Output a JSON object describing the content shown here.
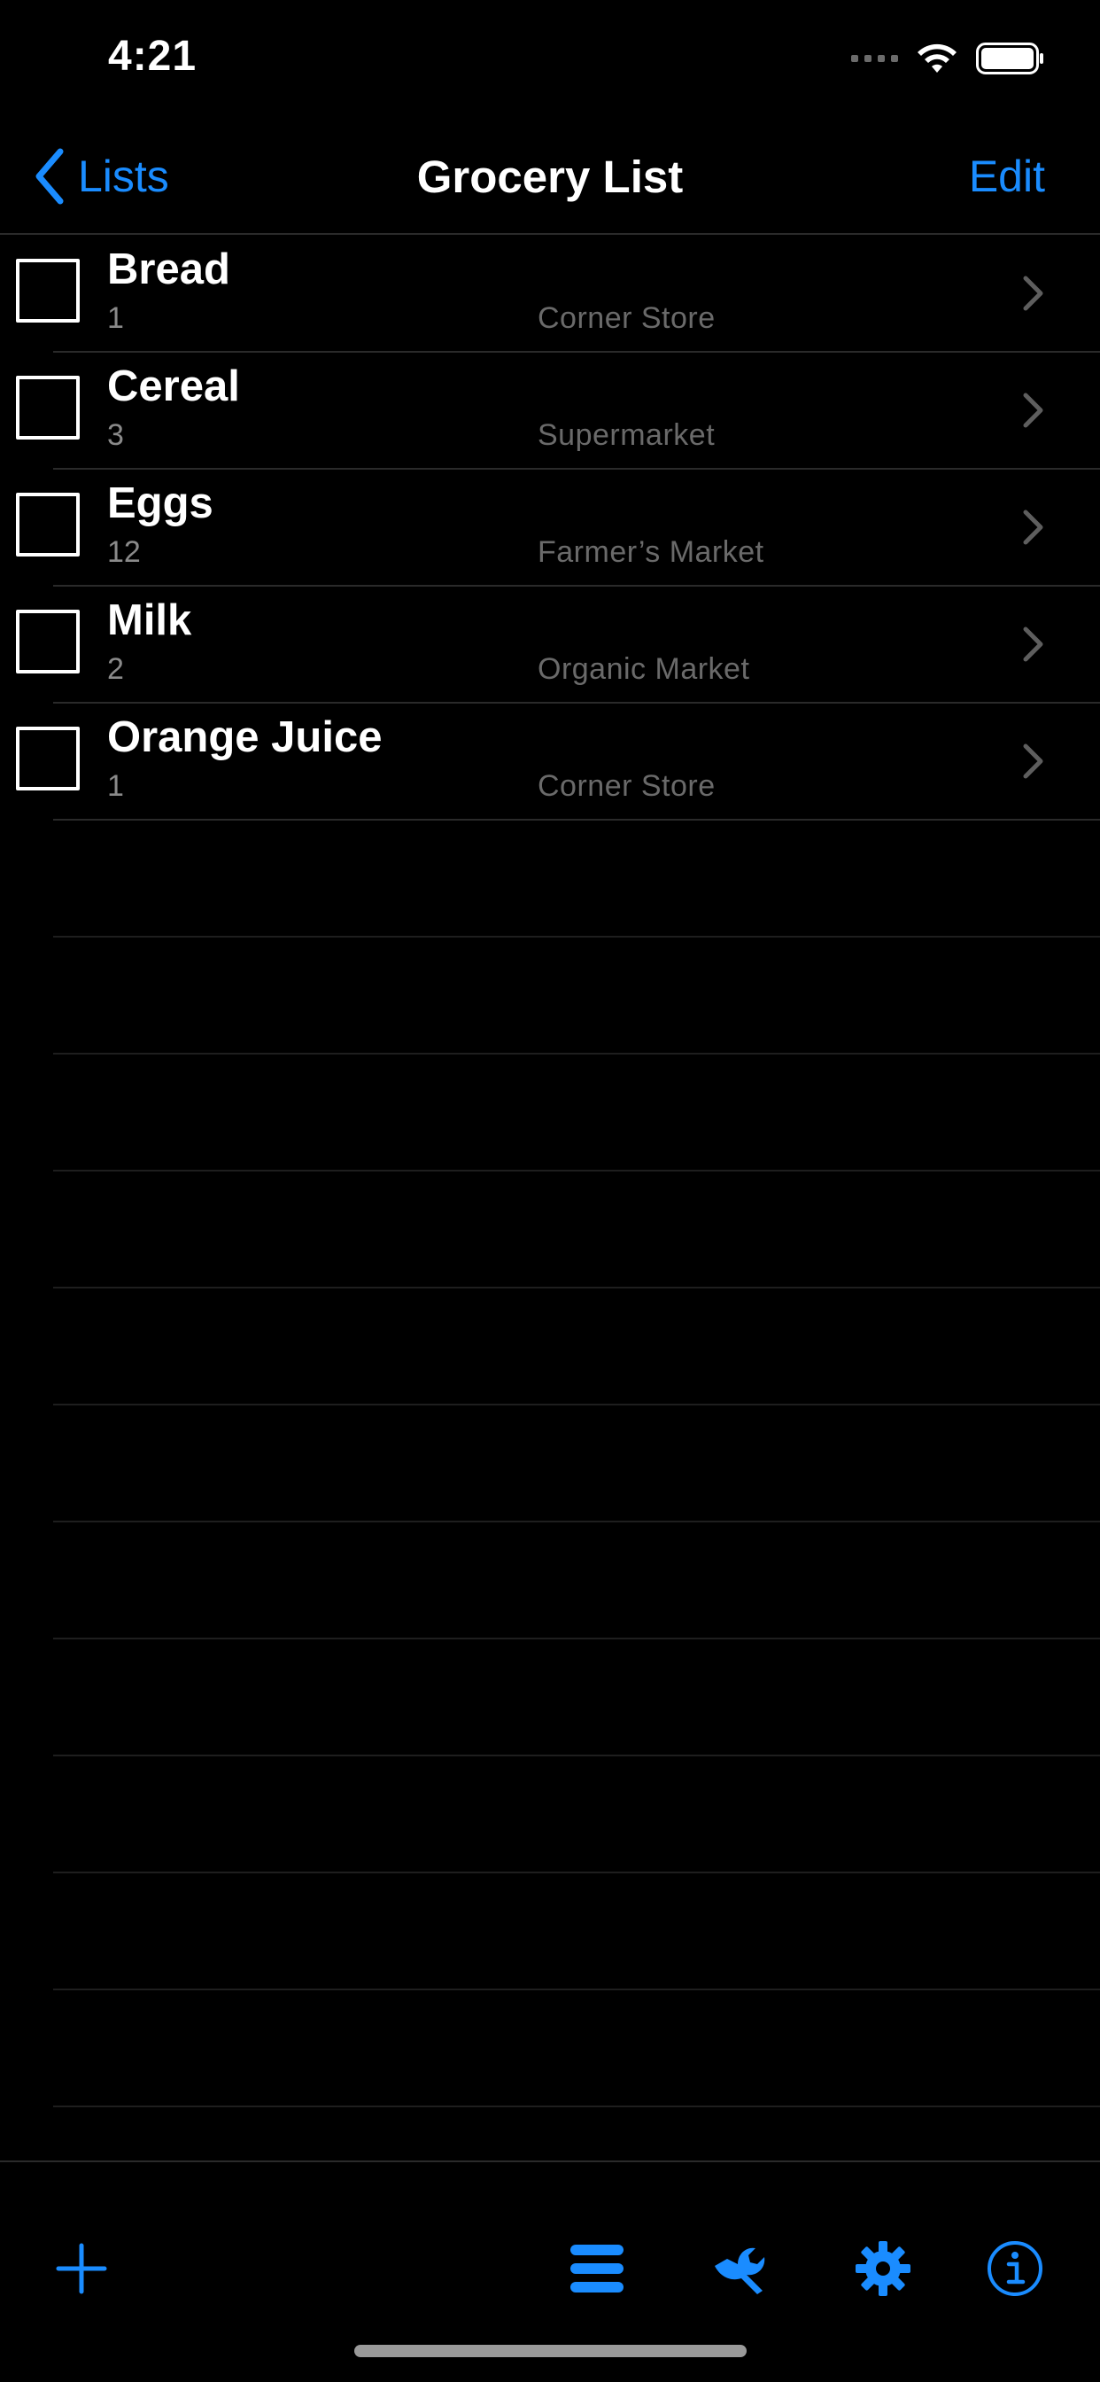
{
  "status_bar": {
    "time": "4:21"
  },
  "nav": {
    "back_label": "Lists",
    "title": "Grocery List",
    "edit_label": "Edit"
  },
  "items": [
    {
      "name": "Bread",
      "quantity": "1",
      "store": "Corner Store"
    },
    {
      "name": "Cereal",
      "quantity": "3",
      "store": "Supermarket"
    },
    {
      "name": "Eggs",
      "quantity": "12",
      "store": "Farmer’s Market"
    },
    {
      "name": "Milk",
      "quantity": "2",
      "store": "Organic Market"
    },
    {
      "name": "Orange Juice",
      "quantity": "1",
      "store": "Corner Store"
    }
  ],
  "toolbar": {
    "icons": [
      "plus-icon",
      "list-icon",
      "wrench-icon",
      "gear-icon",
      "info-icon"
    ]
  },
  "colors": {
    "accent": "#1a8cff",
    "background": "#000000",
    "separator": "#2a2a2a",
    "secondary_text": "#6a6a6a"
  }
}
